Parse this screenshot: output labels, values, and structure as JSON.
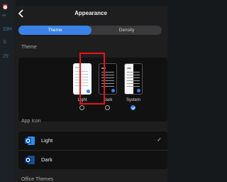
{
  "background": {
    "glyph_top": "⏰",
    "glyph_second": "✏",
    "items": [
      "23H",
      "S",
      "29"
    ]
  },
  "header": {
    "title": "Appearance",
    "back_icon": "chevron-left-icon"
  },
  "tabs": [
    {
      "label": "Theme",
      "selected": true
    },
    {
      "label": "Density",
      "selected": false
    }
  ],
  "theme_section": {
    "heading": "Theme",
    "options": [
      {
        "label": "Light",
        "selected": false
      },
      {
        "label": "Dark",
        "selected": false
      },
      {
        "label": "System",
        "selected": true
      }
    ]
  },
  "app_icon_section": {
    "heading": "App Icon",
    "options": [
      {
        "label": "Light",
        "selected": true
      },
      {
        "label": "Dark",
        "selected": false
      }
    ]
  },
  "office_themes_heading": "Office Themes",
  "colors": {
    "accent": "#3b82e6",
    "highlight_box": "#e8121b",
    "outlook_blue": "#1a6fd1",
    "outlook_dark_blue": "#0b4ea2"
  }
}
